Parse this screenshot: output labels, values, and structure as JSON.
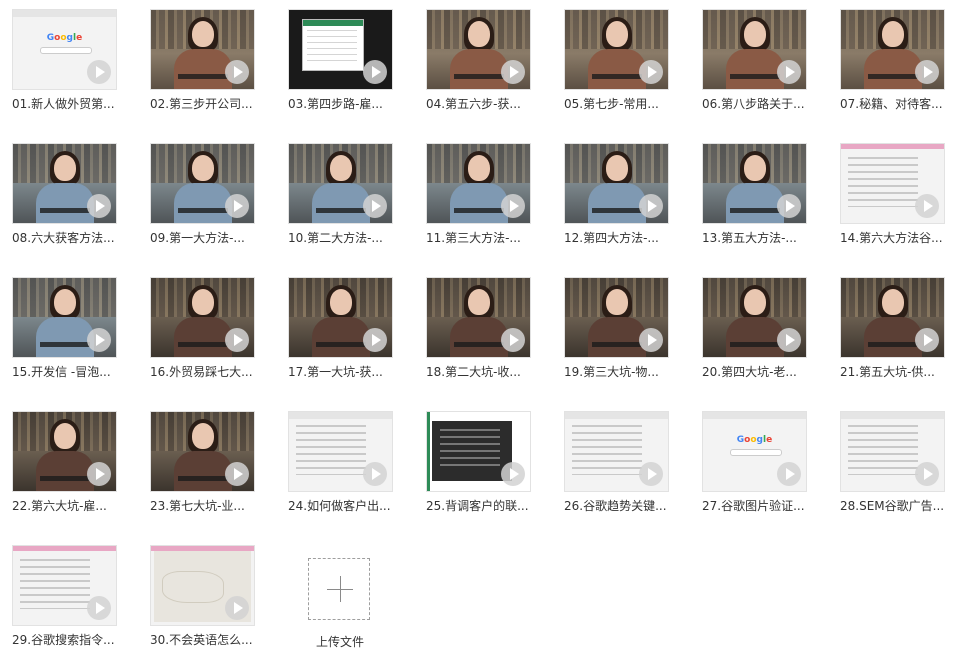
{
  "items": [
    {
      "label": "01.新人做外贸第...",
      "scene": "google"
    },
    {
      "label": "02.第三步开公司...",
      "scene": "room-brown"
    },
    {
      "label": "03.第四步路-雇...",
      "scene": "screen-black"
    },
    {
      "label": "04.第五六步-获...",
      "scene": "room-brown"
    },
    {
      "label": "05.第七步-常用...",
      "scene": "room-brown"
    },
    {
      "label": "06.第八步路关于...",
      "scene": "room-brown"
    },
    {
      "label": "07.秘籍、对待客...",
      "scene": "room-brown"
    },
    {
      "label": "08.六大获客方法...",
      "scene": "office-blue"
    },
    {
      "label": "09.第一大方法-...",
      "scene": "office-blue"
    },
    {
      "label": "10.第二大方法-...",
      "scene": "office-blue"
    },
    {
      "label": "11.第三大方法-...",
      "scene": "office-blue"
    },
    {
      "label": "12.第四大方法-...",
      "scene": "office-blue"
    },
    {
      "label": "13.第五大方法-...",
      "scene": "office-blue"
    },
    {
      "label": "14.第六大方法谷...",
      "scene": "web-pink"
    },
    {
      "label": "15.开发信 -冒泡...",
      "scene": "office-blue"
    },
    {
      "label": "16.外贸易踩七大...",
      "scene": "shelf-dark"
    },
    {
      "label": "17.第一大坑-获...",
      "scene": "shelf-dark"
    },
    {
      "label": "18.第二大坑-收...",
      "scene": "shelf-dark"
    },
    {
      "label": "19.第三大坑-物...",
      "scene": "shelf-dark"
    },
    {
      "label": "20.第四大坑-老...",
      "scene": "shelf-dark"
    },
    {
      "label": "21.第五大坑-供...",
      "scene": "shelf-dark"
    },
    {
      "label": "22.第六大坑-雇...",
      "scene": "shelf-dark"
    },
    {
      "label": "23.第七大坑-业...",
      "scene": "shelf-dark"
    },
    {
      "label": "24.如何做客户出...",
      "scene": "web"
    },
    {
      "label": "25.背调客户的联...",
      "scene": "web-dark"
    },
    {
      "label": "26.谷歌趋势关键...",
      "scene": "web"
    },
    {
      "label": "27.谷歌图片验证...",
      "scene": "google"
    },
    {
      "label": "28.SEM谷歌广告...",
      "scene": "web"
    },
    {
      "label": "29.谷歌搜索指令...",
      "scene": "web-pink"
    },
    {
      "label": "30.不会英语怎么...",
      "scene": "map"
    }
  ],
  "upload": {
    "label": "上传文件",
    "icon": "plus-icon"
  },
  "google": {
    "letters": [
      "G",
      "o",
      "o",
      "g",
      "l",
      "e"
    ]
  }
}
